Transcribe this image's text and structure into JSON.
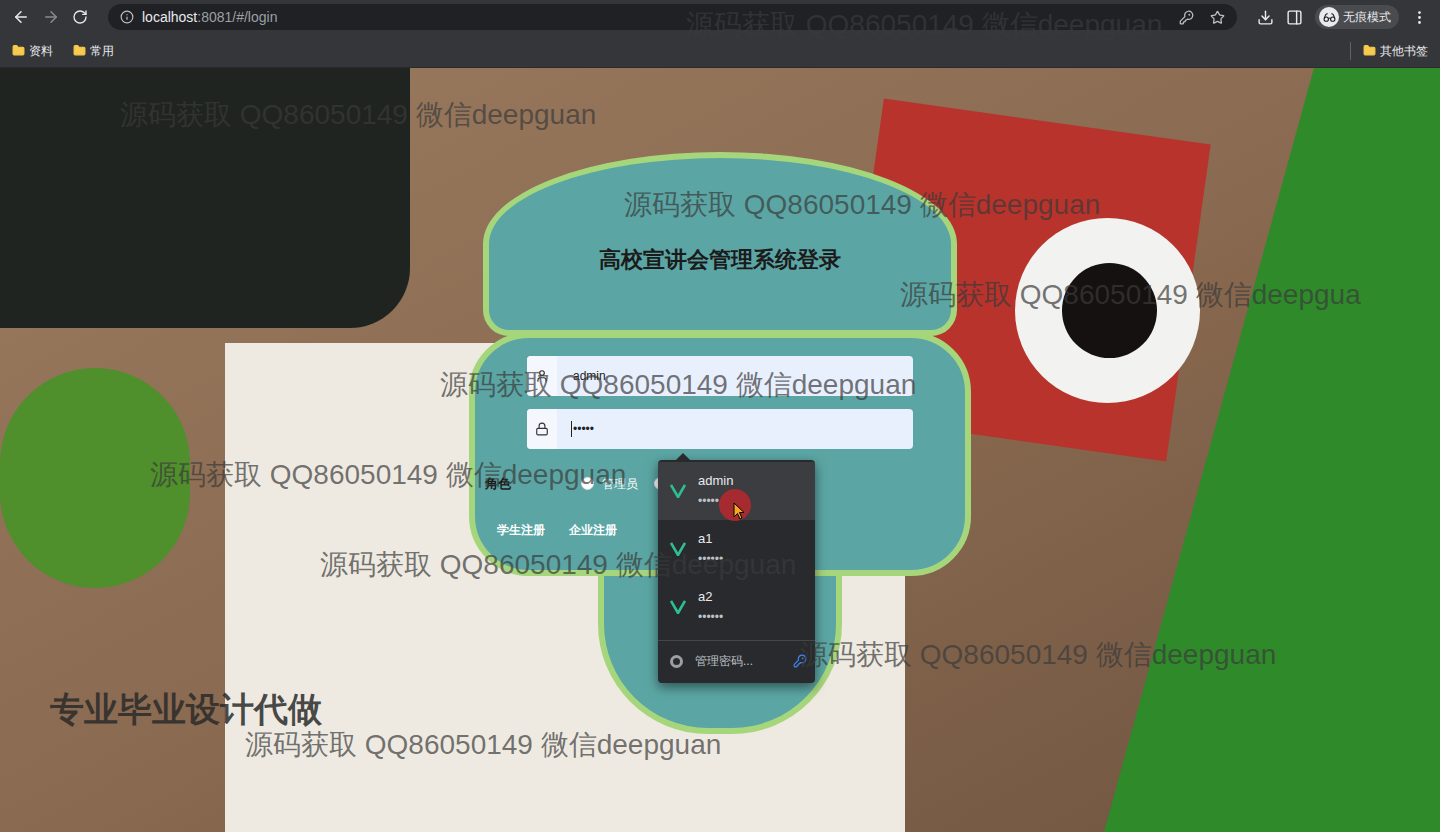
{
  "browser": {
    "url_host": "localhost",
    "url_path": ":8081/#/login",
    "profile": "无痕模式"
  },
  "bookmarks": [
    {
      "label": "资料"
    },
    {
      "label": "常用"
    }
  ],
  "other_bookmarks": "其他书签",
  "login": {
    "title": "高校宣讲会管理系统登录",
    "username": "admin",
    "password": "•••••",
    "role_label": "角色",
    "roles": [
      {
        "label": "管理员",
        "selected": false
      },
      {
        "label": "",
        "selected": false
      }
    ],
    "links": [
      "学生注册",
      "企业注册"
    ]
  },
  "autofill": {
    "items": [
      {
        "username": "admin",
        "password": "•••••",
        "highlighted": true
      },
      {
        "username": "a1",
        "password": "••••••",
        "highlighted": false
      },
      {
        "username": "a2",
        "password": "••••••",
        "highlighted": false
      }
    ],
    "manage": "管理密码..."
  },
  "watermarks": [
    "源码获取 QQ86050149 微信deepguan",
    "源码获取 QQ86050149 微信deepguan",
    "源码获取 QQ86050149 微信deepguan",
    "源码获取 QQ86050149 微信deepgua",
    "源码获取 QQ86050149 微信deepguan",
    "源码获取 QQ86050149 微信deepguan",
    "源码获取 QQ86050149 微信deepguan",
    "源码获取 QQ86050149 微信deepguan",
    "源码获取 QQ86050149 微信deepguan"
  ],
  "banner": "专业毕业设计代做"
}
